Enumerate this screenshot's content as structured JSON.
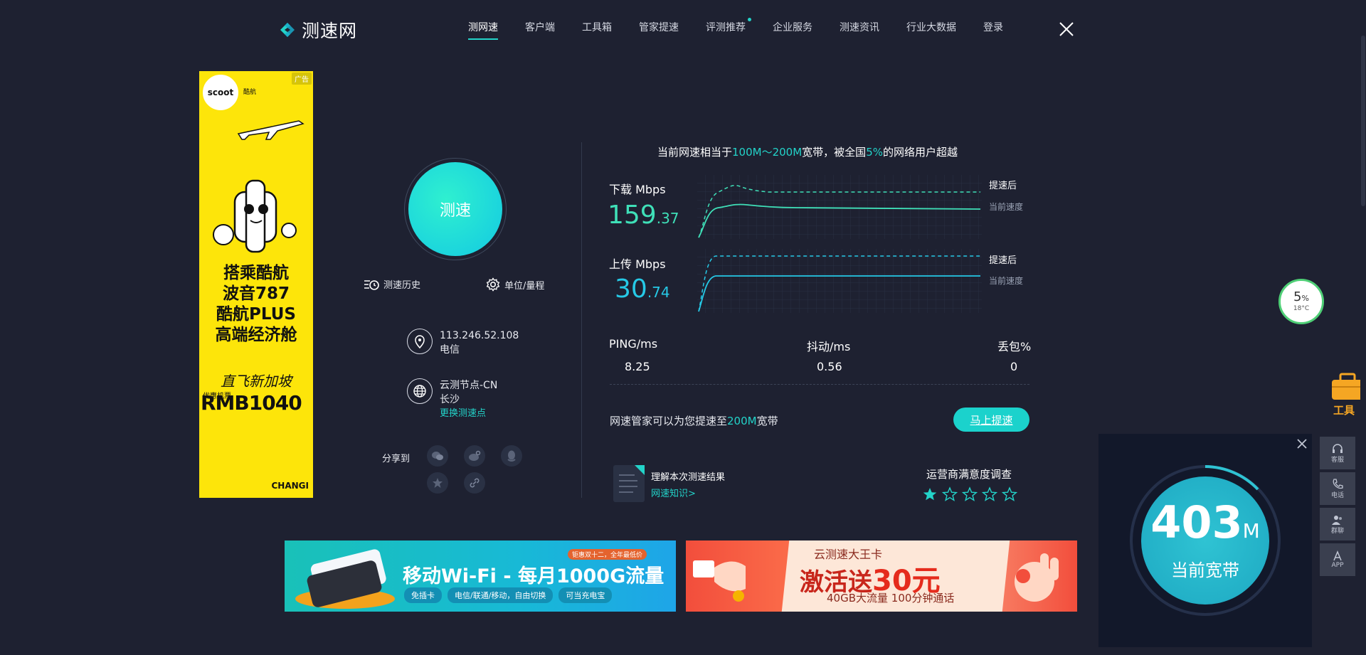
{
  "brand": {
    "name": "测速网"
  },
  "nav": [
    {
      "label": "测网速",
      "active": true
    },
    {
      "label": "客户端"
    },
    {
      "label": "工具箱"
    },
    {
      "label": "管家提速"
    },
    {
      "label": "评测推荐",
      "dot": true
    },
    {
      "label": "企业服务"
    },
    {
      "label": "测速资讯"
    },
    {
      "label": "行业大数据"
    },
    {
      "label": "登录"
    }
  ],
  "ad_vertical": {
    "tag": "广告",
    "brand": "scoot",
    "brand_sub": "酷航",
    "headline": [
      "搭乘酷航",
      "波音787",
      "酷航PLUS",
      "高端经济舱"
    ],
    "tagline": "直飞新加坡",
    "price_label": "优惠机票",
    "price": "RMB1040",
    "partner": "CHANGI"
  },
  "speedtest": {
    "button": "测速",
    "history": "测速历史",
    "units": "单位/量程",
    "ip": "113.246.52.108",
    "isp": "电信",
    "node": "云测节点-CN",
    "city": "长沙",
    "change_node": "更换测速点",
    "share_label": "分享到"
  },
  "summary": {
    "prefix": "当前网速相当于",
    "range": "100M～200M",
    "middle": "宽带，被全国",
    "percent": "5%",
    "suffix": "的网络用户超越"
  },
  "download": {
    "label": "下载 Mbps",
    "int": "159",
    "dec": ".37",
    "legend_after": "提速后",
    "legend_current": "当前速度"
  },
  "upload": {
    "label": "上传 Mbps",
    "int": "30",
    "dec": ".74",
    "legend_after": "提速后",
    "legend_current": "当前速度"
  },
  "stats": [
    {
      "label": "PING/ms",
      "value": "8.25"
    },
    {
      "label": "抖动/ms",
      "value": "0.56"
    },
    {
      "label": "丢包%",
      "value": "0"
    }
  ],
  "boost": {
    "prefix": "网速管家可以为您提速至",
    "target": "200M",
    "suffix": "宽带",
    "button": "马上提速"
  },
  "result": {
    "understand": "理解本次测速结果",
    "knowledge": "网速知识>"
  },
  "survey": {
    "title": "运营商满意度调查",
    "rating": 1,
    "max": 5
  },
  "banner1": {
    "title": "移动Wi-Fi - 每月1000G流量",
    "corner": "钜惠双十二，全年最低价",
    "tags": [
      "免插卡",
      "电信/联通/移动，自由切换",
      "可当充电宝"
    ]
  },
  "banner2": {
    "small": "云测速大王卡",
    "big_prefix": "激活送",
    "big_num": "30元",
    "sub": "40GB大流量    100分钟通话"
  },
  "widget": {
    "percent": "5",
    "unit": "%",
    "temp": "18°C"
  },
  "tool_label": "工具",
  "side_menu": [
    "客服",
    "电话",
    "群聊",
    "APP"
  ],
  "popup": {
    "value": "403",
    "unit": "M",
    "label": "当前宽带"
  },
  "colors": {
    "accent": "#23d3c9",
    "bg": "#1e2131"
  }
}
